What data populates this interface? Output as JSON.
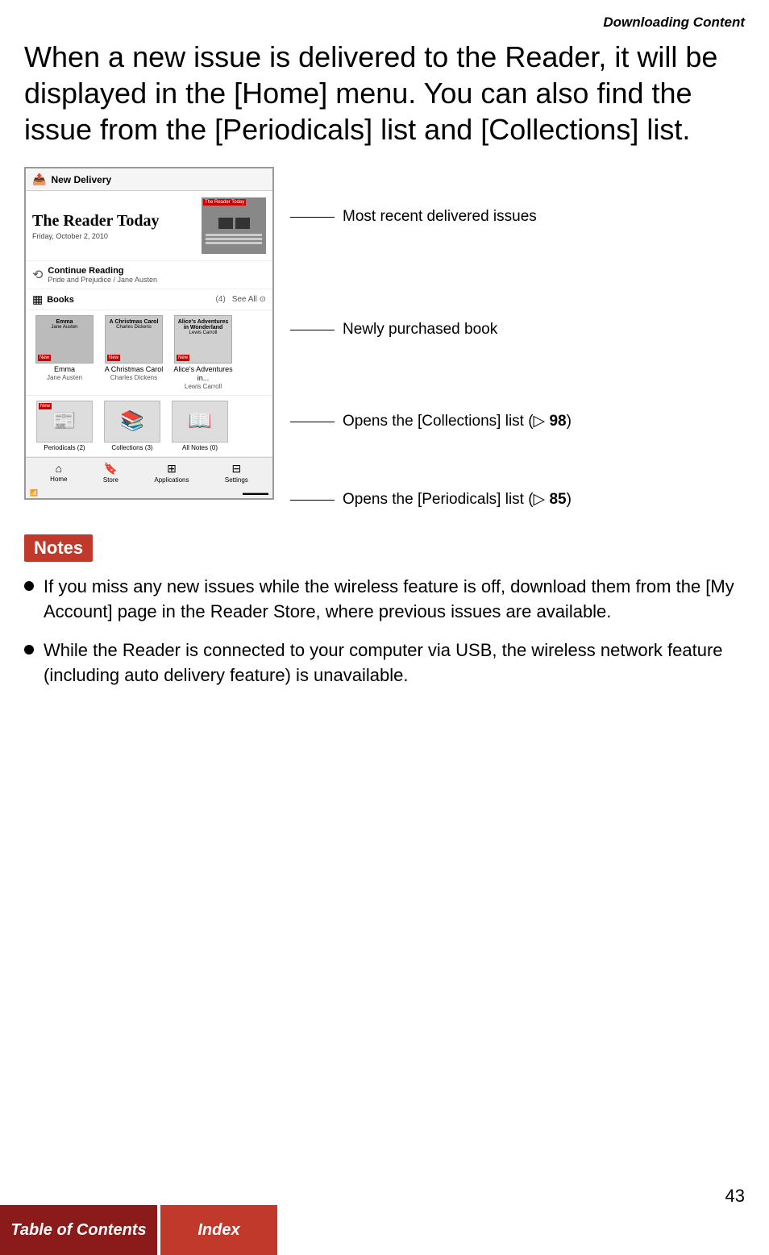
{
  "header": {
    "title": "Downloading Content"
  },
  "main_text": "When a new issue is delivered to the Reader, it will be displayed in the [Home] menu. You can also find the issue from the [Periodicals] list and [Collections] list.",
  "device": {
    "new_delivery_label": "New Delivery",
    "hero_title": "The Reader Today",
    "hero_date": "Friday, October 2, 2010",
    "continue_reading_label": "Continue Reading",
    "continue_reading_sub": "Pride and Prejudice / Jane Austen",
    "books_label": "Books",
    "books_count": "(4)",
    "see_all": "See All",
    "books": [
      {
        "title": "Emma",
        "author": "Jane Austen"
      },
      {
        "title": "A Christmas Carol",
        "author": "Charles Dickens"
      },
      {
        "title": "Alice's Adventures in...",
        "author": "Lewis Carroll"
      }
    ],
    "bottom_items": [
      {
        "label": "Periodicals (2)"
      },
      {
        "label": "Collections (3)"
      },
      {
        "label": "All Notes (0)"
      }
    ],
    "nav_items": [
      {
        "label": "Home"
      },
      {
        "label": "Store"
      },
      {
        "label": "Applications"
      },
      {
        "label": "Settings"
      }
    ]
  },
  "annotations": [
    {
      "text": "Most recent delivered issues"
    },
    {
      "text": "Newly purchased book"
    },
    {
      "text": "Opens the [Collections] list (",
      "ref": "98",
      "suffix": ")"
    },
    {
      "text": "Opens the [Periodicals] list (",
      "ref": "85",
      "suffix": ")"
    }
  ],
  "notes": {
    "badge_label": "Notes",
    "items": [
      "If you miss any new issues while the wireless feature is off, download them from the [My Account] page in the Reader Store, where previous issues are available.",
      "While the Reader is connected to your computer via USB, the wireless network feature (including auto delivery feature) is unavailable."
    ]
  },
  "page_number": "43",
  "footer": {
    "toc_label": "Table of Contents",
    "index_label": "Index"
  }
}
